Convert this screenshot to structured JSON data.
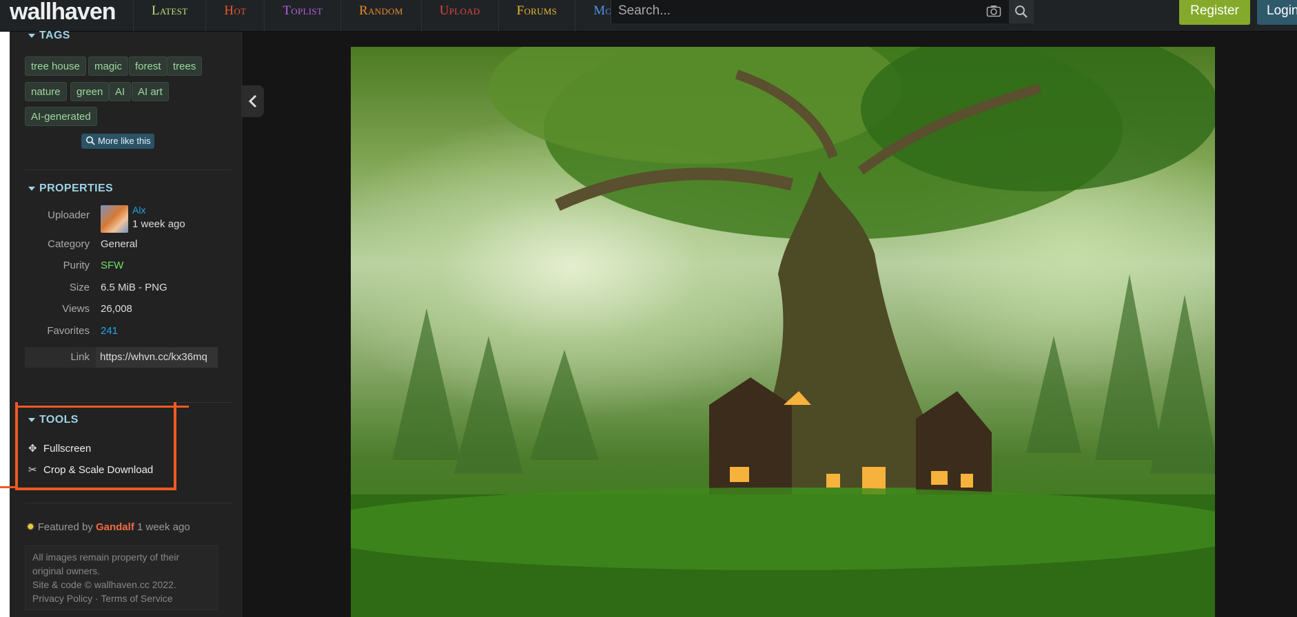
{
  "app": {
    "logo": "wallhaven"
  },
  "nav": [
    {
      "label": "Latest",
      "color": "#c5e07a"
    },
    {
      "label": "Hot",
      "color": "#e8562f"
    },
    {
      "label": "Toplist",
      "color": "#b65fde"
    },
    {
      "label": "Random",
      "color": "#eb8a2c"
    },
    {
      "label": "Upload",
      "color": "#e0473f"
    },
    {
      "label": "Forums",
      "color": "#e8b935"
    },
    {
      "label": "More",
      "color": "#4d93de"
    }
  ],
  "search": {
    "placeholder": "Search..."
  },
  "account": {
    "register": "Register",
    "login": "Login"
  },
  "tags": {
    "title": "TAGS",
    "items": [
      "tree house",
      "magic",
      "forest",
      "trees",
      "nature",
      "green",
      "AI",
      "AI art",
      "AI-generated"
    ],
    "more_like": "More like this"
  },
  "properties": {
    "title": "PROPERTIES",
    "uploader_label": "Uploader",
    "uploader_name": "Alx",
    "uploader_time": "1 week ago",
    "category_label": "Category",
    "category": "General",
    "purity_label": "Purity",
    "purity": "SFW",
    "size_label": "Size",
    "size": "6.5 MiB - PNG",
    "views_label": "Views",
    "views": "26,008",
    "favorites_label": "Favorites",
    "favorites": "241",
    "link_label": "Link",
    "link": "https://whvn.cc/kx36mq"
  },
  "tools": {
    "title": "TOOLS",
    "fullscreen": "Fullscreen",
    "crop": "Crop & Scale Download"
  },
  "featured": {
    "prefix": "Featured by",
    "user": "Gandalf",
    "time": "1 week ago"
  },
  "footer": {
    "line1": "All images remain property of their",
    "line2": "original owners.",
    "line3": "Site & code © wallhaven.cc 2022.",
    "privacy": "Privacy Policy",
    "sep": " · ",
    "terms": "Terms of Service"
  },
  "colors": {
    "accent": "#9ed3e6",
    "sfw": "#6fe36a",
    "favorites": "#25a6e9",
    "highlight": "#f05a22"
  }
}
